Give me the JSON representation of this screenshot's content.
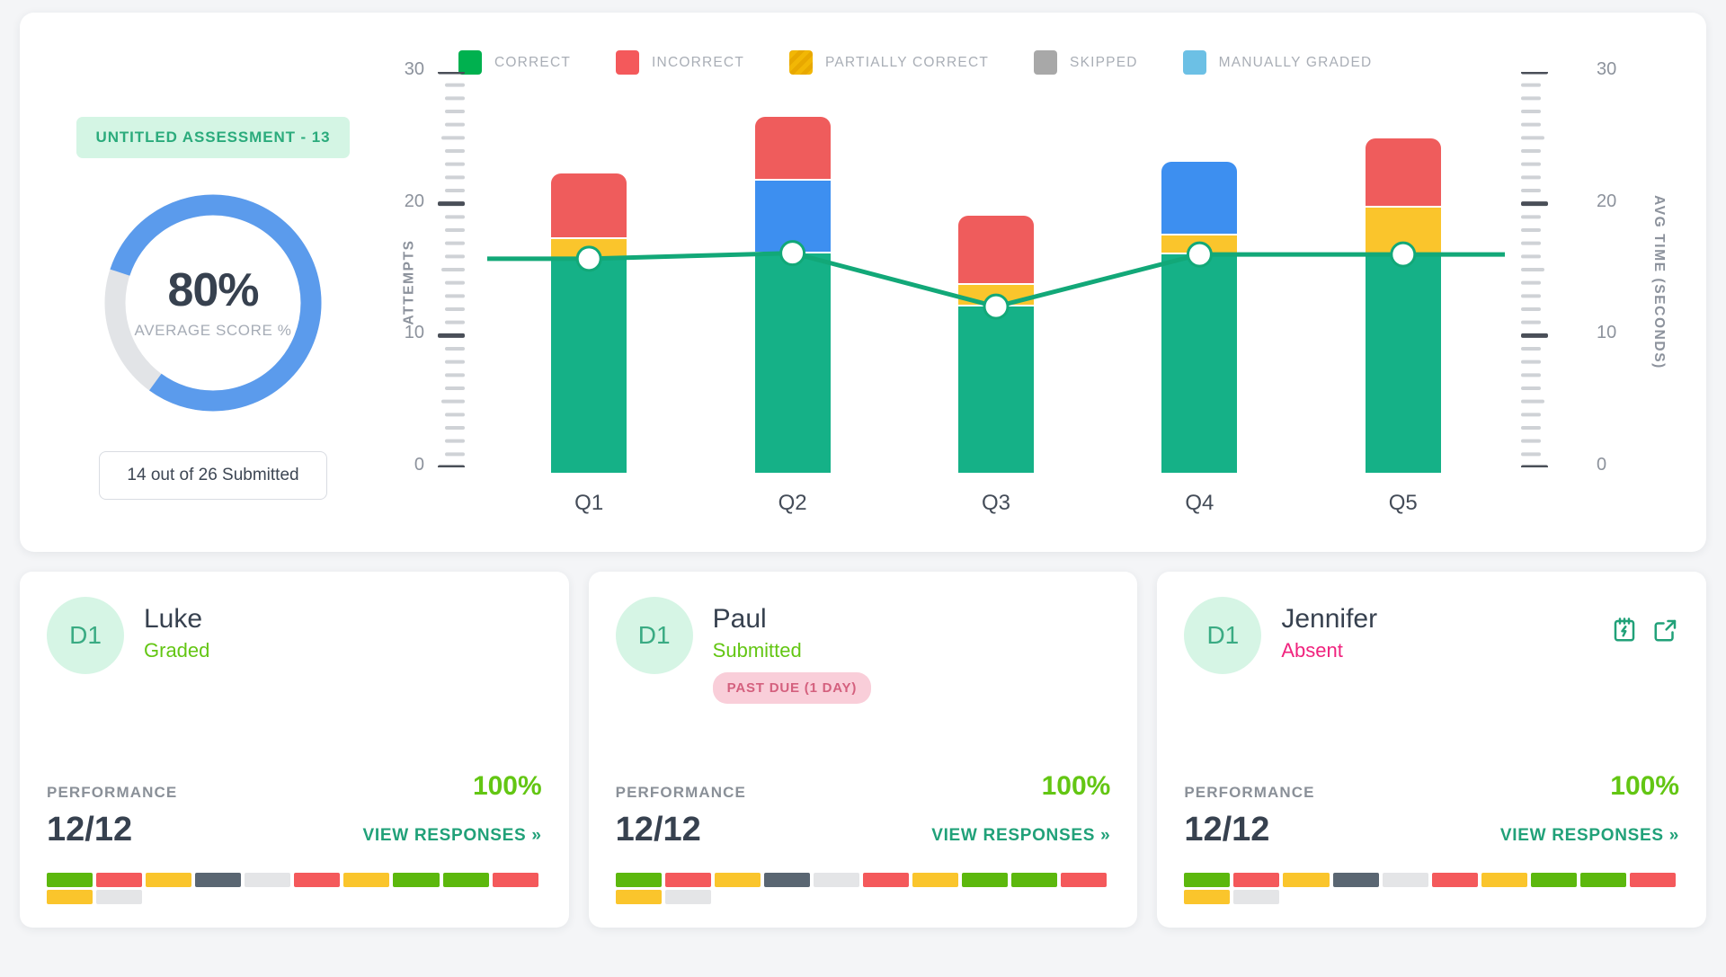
{
  "summary": {
    "assessment_chip": "UNTITLED ASSESSMENT - 13",
    "donut_percent_label": "80%",
    "donut_caption": "AVERAGE SCORE %",
    "donut_value": 80,
    "submitted_button": "14 out of 26 Submitted"
  },
  "colors": {
    "correct": "#00b14f",
    "incorrect": "#f4595b",
    "partially_correct": "#f2b705",
    "skipped": "#a8a8a8",
    "manually_graded": "#6cc0e5",
    "bar_correct": "#15b187",
    "bar_incorrect": "#ef5c5c",
    "bar_partial": "#fac52c",
    "bar_manual": "#3d8ff0",
    "line": "#12a878",
    "donut_fill": "#5b9bec",
    "donut_track": "#e2e4e7",
    "chip_bg": "#d4f5e4",
    "chip_text": "#2bab7c",
    "graded_text": "#63c613",
    "absent_text": "#f0237e",
    "past_due_bg": "#f9ced9",
    "past_due_text": "#d4607e",
    "teal_icon": "#21a179",
    "seg_green": "#5cb80d",
    "seg_red": "#f4595b",
    "seg_yellow": "#fac52c",
    "seg_darkgray": "#5a6672",
    "seg_lightgray": "#e4e5e7"
  },
  "chart_data": {
    "type": "bar",
    "title": "",
    "xlabel": "",
    "ylabel": "ATTEMPTS",
    "y2label": "AVG TIME (SECONDS)",
    "categories": [
      "Q1",
      "Q2",
      "Q3",
      "Q4",
      "Q5"
    ],
    "ylim": [
      0,
      30
    ],
    "y2lim": [
      0,
      30
    ],
    "yticks": [
      0,
      10,
      20,
      30
    ],
    "y2ticks": [
      0,
      10,
      20,
      30
    ],
    "grid": false,
    "legend_position": "top",
    "legend": [
      {
        "label": "CORRECT",
        "color": "#00b14f",
        "pattern": "solid"
      },
      {
        "label": "INCORRECT",
        "color": "#f4595b",
        "pattern": "solid"
      },
      {
        "label": "PARTIALLY CORRECT",
        "color": "#f2b705",
        "pattern": "diagonal-stripes"
      },
      {
        "label": "SKIPPED",
        "color": "#a8a8a8",
        "pattern": "solid"
      },
      {
        "label": "MANUALLY GRADED",
        "color": "#6cc0e5",
        "pattern": "solid"
      }
    ],
    "series": [
      {
        "name": "CORRECT",
        "values": [
          15.2,
          15.6,
          11.8,
          15.5,
          15.5
        ]
      },
      {
        "name": "PARTIALLY CORRECT",
        "values": [
          1.3,
          0,
          1.4,
          1.2,
          3.2
        ]
      },
      {
        "name": "MANUALLY GRADED",
        "values": [
          0,
          5.0,
          0,
          5.1,
          0
        ]
      },
      {
        "name": "INCORRECT",
        "values": [
          4.5,
          4.4,
          4.8,
          0,
          4.8
        ]
      }
    ],
    "line_series": {
      "name": "AVG TIME (SECONDS)",
      "axis": "right",
      "values": [
        15.2,
        15.6,
        11.8,
        15.5,
        15.5
      ],
      "marker": "circle"
    }
  },
  "cards": [
    {
      "avatar_initials": "D1",
      "name": "Luke",
      "status": "Graded",
      "status_kind": "graded",
      "past_due": null,
      "performance_label": "PERFORMANCE",
      "percent": "100%",
      "score": "12/12",
      "view_link": "VIEW RESPONSES »",
      "has_actions": false,
      "segments": [
        "green",
        "red",
        "yellow",
        "darkgray",
        "lightgray",
        "red",
        "yellow",
        "green",
        "green",
        "red",
        "yellow",
        "lightgray"
      ]
    },
    {
      "avatar_initials": "D1",
      "name": "Paul",
      "status": "Submitted",
      "status_kind": "submitted",
      "past_due": "PAST DUE (1 DAY)",
      "performance_label": "PERFORMANCE",
      "percent": "100%",
      "score": "12/12",
      "view_link": "VIEW RESPONSES »",
      "has_actions": false,
      "segments": [
        "green",
        "red",
        "yellow",
        "darkgray",
        "lightgray",
        "red",
        "yellow",
        "green",
        "green",
        "red",
        "yellow",
        "lightgray"
      ]
    },
    {
      "avatar_initials": "D1",
      "name": "Jennifer",
      "status": "Absent",
      "status_kind": "absent",
      "past_due": null,
      "performance_label": "PERFORMANCE",
      "percent": "100%",
      "score": "12/12",
      "view_link": "VIEW RESPONSES »",
      "has_actions": true,
      "action_icons": [
        "notepad-icon",
        "external-link-icon"
      ],
      "segments": [
        "green",
        "red",
        "yellow",
        "darkgray",
        "lightgray",
        "red",
        "yellow",
        "green",
        "green",
        "red",
        "yellow",
        "lightgray"
      ]
    }
  ]
}
